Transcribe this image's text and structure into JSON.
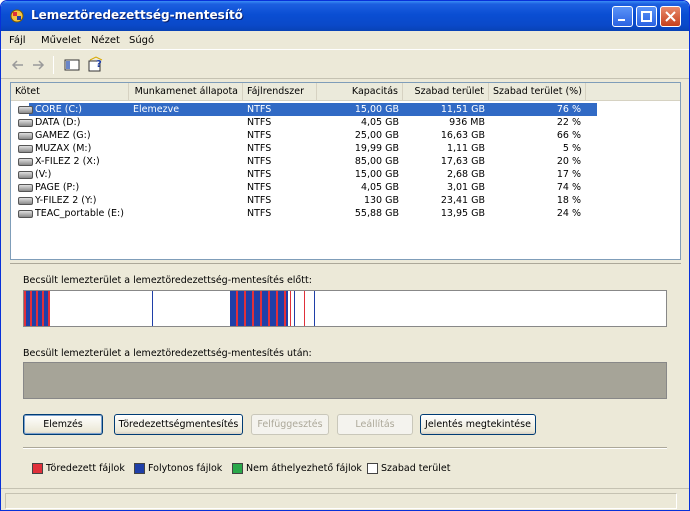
{
  "window": {
    "title": "Lemeztöredezettség-mentesítő"
  },
  "menu": [
    "Fájl",
    "Művelet",
    "Nézet",
    "Súgó"
  ],
  "columns": [
    "Kötet",
    "Munkamenet állapota",
    "Fájlrendszer",
    "Kapacitás",
    "Szabad terület",
    "Szabad terület (%)"
  ],
  "volumes": [
    {
      "name": "CORE (C:)",
      "status": "Elemezve",
      "fs": "NTFS",
      "capacity": "15,00 GB",
      "free": "11,51 GB",
      "pct": "76 %",
      "selected": true
    },
    {
      "name": "DATA (D:)",
      "status": "",
      "fs": "NTFS",
      "capacity": "4,05 GB",
      "free": "936 MB",
      "pct": "22 %"
    },
    {
      "name": "GAMEZ (G:)",
      "status": "",
      "fs": "NTFS",
      "capacity": "25,00 GB",
      "free": "16,63 GB",
      "pct": "66 %"
    },
    {
      "name": "MUZAX (M:)",
      "status": "",
      "fs": "NTFS",
      "capacity": "19,99 GB",
      "free": "1,11 GB",
      "pct": "5 %"
    },
    {
      "name": "X-FILEZ 2 (X:)",
      "status": "",
      "fs": "NTFS",
      "capacity": "85,00 GB",
      "free": "17,63 GB",
      "pct": "20 %"
    },
    {
      "name": "(V:)",
      "status": "",
      "fs": "NTFS",
      "capacity": "15,00 GB",
      "free": "2,68 GB",
      "pct": "17 %"
    },
    {
      "name": "PAGE (P:)",
      "status": "",
      "fs": "NTFS",
      "capacity": "4,05 GB",
      "free": "3,01 GB",
      "pct": "74 %"
    },
    {
      "name": "Y-FILEZ 2 (Y:)",
      "status": "",
      "fs": "NTFS",
      "capacity": "130 GB",
      "free": "23,41 GB",
      "pct": "18 %"
    },
    {
      "name": "TEAC_portable (E:)",
      "status": "",
      "fs": "NTFS",
      "capacity": "55,88 GB",
      "free": "13,95 GB",
      "pct": "24 %"
    }
  ],
  "panel": {
    "before_label": "Becsült lemezterület a lemeztöredezettség-mentesítés előtt:",
    "after_label": "Becsült lemezterület a lemeztöredezettség-mentesítés után:"
  },
  "buttons": {
    "analyze": "Elemzés",
    "defrag": "Töredezettségmentesítés",
    "pause": "Felfüggesztés",
    "stop": "Leállítás",
    "report": "Jelentés megtekintése"
  },
  "legend": [
    {
      "label": "Töredezett fájlok",
      "color": "#e0303a"
    },
    {
      "label": "Folytonos fájlok",
      "color": "#1f3fa8"
    },
    {
      "label": "Nem áthelyezhető fájlok",
      "color": "#2aa84a"
    },
    {
      "label": "Szabad terület",
      "color": "#ffffff"
    }
  ],
  "colors": {
    "title_bar": "#0a4ed3",
    "selection": "#316ac5",
    "fragmented": "#e0303a",
    "contiguous": "#1f3fa8"
  }
}
